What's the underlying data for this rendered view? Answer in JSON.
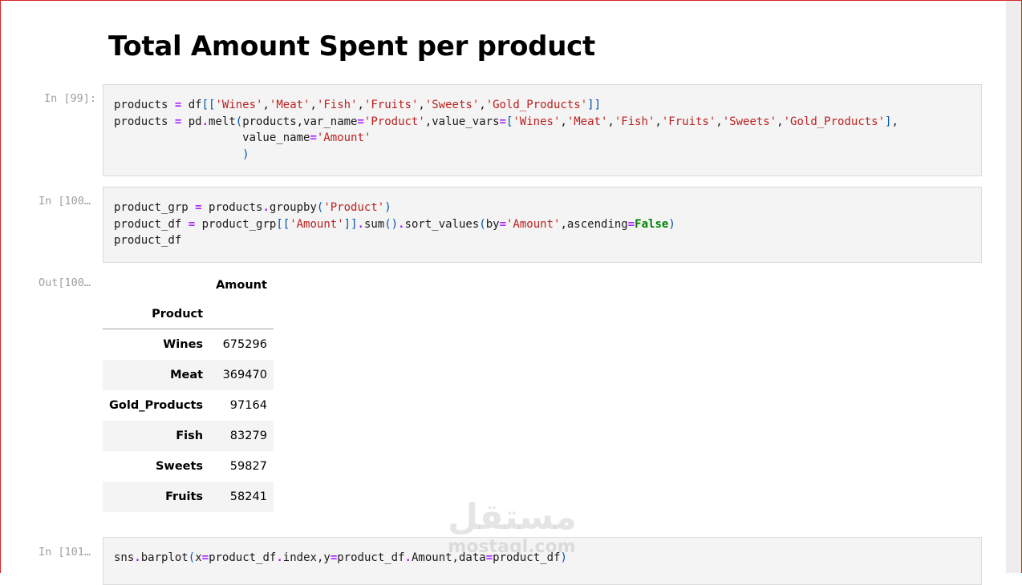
{
  "notebook": {
    "heading": "Total Amount Spent per product",
    "cells": [
      {
        "prompt": "In [99]:",
        "lines": [
          "products = df[['Wines','Meat','Fish','Fruits','Sweets','Gold_Products']]",
          "products = pd.melt(products,var_name='Product',value_vars=['Wines','Meat','Fish','Fruits','Sweets','Gold_Products'],",
          "                   value_name='Amount'",
          "                   )"
        ]
      },
      {
        "prompt": "In [100…",
        "lines": [
          "product_grp = products.groupby('Product')",
          "product_df = product_grp[['Amount']].sum().sort_values(by='Amount',ascending=False)",
          "product_df"
        ]
      },
      {
        "prompt": "In [101…",
        "lines": [
          "sns.barplot(x=product_df.index,y=product_df.Amount,data=product_df)"
        ]
      }
    ],
    "output": {
      "prompt": "Out[100…",
      "column_header": "Amount",
      "index_name": "Product",
      "rows": [
        {
          "product": "Wines",
          "amount": "675296"
        },
        {
          "product": "Meat",
          "amount": "369470"
        },
        {
          "product": "Gold_Products",
          "amount": "97164"
        },
        {
          "product": "Fish",
          "amount": "83279"
        },
        {
          "product": "Sweets",
          "amount": "59827"
        },
        {
          "product": "Fruits",
          "amount": "58241"
        }
      ]
    }
  },
  "watermark": {
    "arabic": "مستقل",
    "latin": "mostaql.com"
  },
  "colors": {
    "string": "#ba2121",
    "operator": "#aa22ff",
    "keyword": "#008000",
    "frame_border": "#d9262b"
  }
}
